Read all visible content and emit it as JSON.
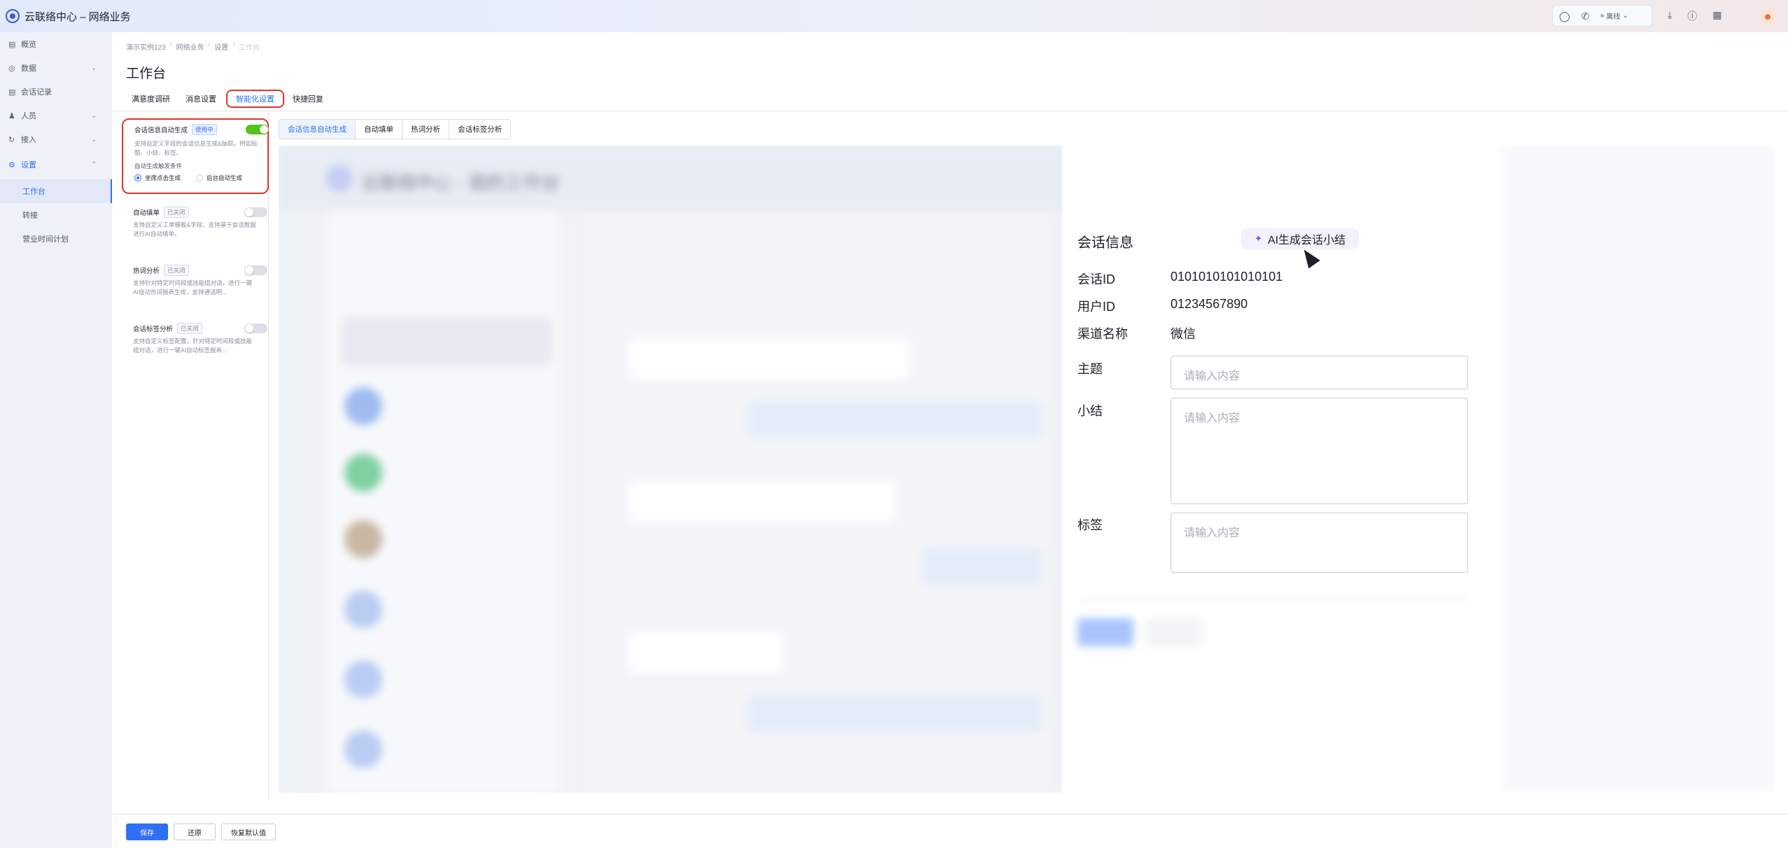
{
  "app": {
    "title": "云联络中心 – 网络业务"
  },
  "topbar": {
    "status": "离线",
    "icons": [
      "chat-icon",
      "phone-icon",
      "download-icon",
      "help-icon",
      "grid-icon"
    ]
  },
  "sidebar": {
    "items": [
      {
        "label": "概览",
        "icon": "overview-icon"
      },
      {
        "label": "数据",
        "icon": "data-icon",
        "chevron": "down"
      },
      {
        "label": "会话记录",
        "icon": "record-icon"
      },
      {
        "label": "人员",
        "icon": "people-icon",
        "chevron": "down"
      },
      {
        "label": "接入",
        "icon": "access-icon",
        "chevron": "down"
      },
      {
        "label": "设置",
        "icon": "settings-icon",
        "chevron": "up"
      }
    ],
    "sub_items": [
      {
        "label": "工作台",
        "active": true
      },
      {
        "label": "转接"
      },
      {
        "label": "营业时间计划"
      }
    ]
  },
  "breadcrumb": [
    "演示实例123",
    "网络业务",
    "设置",
    "工作台"
  ],
  "page": {
    "title": "工作台"
  },
  "tabs": [
    {
      "label": "满意度调研"
    },
    {
      "label": "消息设置"
    },
    {
      "label": "智能化设置",
      "active": true
    },
    {
      "label": "快捷回复"
    }
  ],
  "features": [
    {
      "title": "会话信息自动生成",
      "badge": "使用中",
      "enabled": true,
      "desc": "支持自定义字段的会话信息生成&抽取。例如标题、小结、标签。",
      "condition_label": "自动生成触发条件",
      "options": [
        {
          "label": "坐席点击生成",
          "selected": true
        },
        {
          "label": "后台自动生成",
          "selected": false
        }
      ]
    },
    {
      "title": "自动填单",
      "badge": "已关闭",
      "enabled": false,
      "desc": "支持自定义工单模板&字段，支持基于会话数据进行AI自动填单。"
    },
    {
      "title": "热词分析",
      "badge": "已关闭",
      "enabled": false,
      "desc": "支持针对特定时间段或技能组对话，进行一键AI自动热词报表生成，支持通话明..."
    },
    {
      "title": "会话标签分析",
      "badge": "已关闭",
      "enabled": false,
      "desc": "支持自定义标签配置，针对特定时间段或技能组对话，进行一键AI自动标签报表..."
    }
  ],
  "subtabs": [
    {
      "label": "会话信息自动生成",
      "active": true
    },
    {
      "label": "自动填单"
    },
    {
      "label": "热词分析"
    },
    {
      "label": "会话标签分析"
    }
  ],
  "preview": {
    "blurred_header": "云联络中心 · 我的工作台",
    "panel": {
      "title": "会话信息",
      "ai_button": "AI生成会话小结",
      "fields": [
        {
          "label": "会话ID",
          "value": "0101010101010101"
        },
        {
          "label": "用户ID",
          "value": "01234567890"
        },
        {
          "label": "渠道名称",
          "value": "微信"
        }
      ],
      "inputs": [
        {
          "label": "主题",
          "placeholder": "请输入内容"
        },
        {
          "label": "小结",
          "placeholder": "请输入内容"
        },
        {
          "label": "标签",
          "placeholder": "请输入内容"
        }
      ]
    }
  },
  "footer": {
    "save": "保存",
    "restore": "还原",
    "reset_default": "恢复默认值"
  },
  "colors": {
    "primary": "#2f6ff5",
    "highlight": "#e0352b",
    "toggle_on": "#52c41a"
  }
}
